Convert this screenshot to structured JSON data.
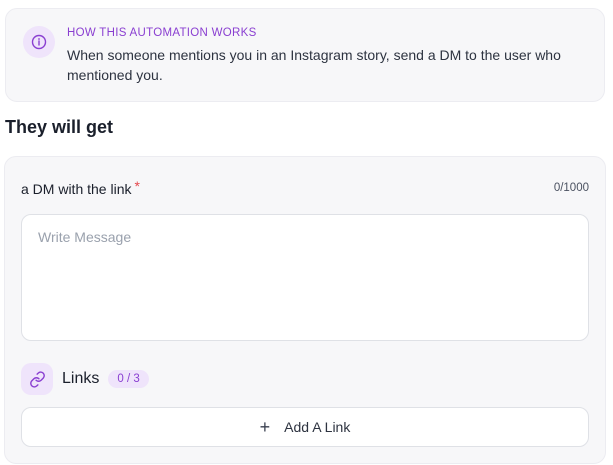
{
  "info": {
    "icon": "info-icon",
    "title": "HOW THIS AUTOMATION WORKS",
    "description": "When someone mentions you in an Instagram story, send a DM to the user who mentioned you."
  },
  "section": {
    "heading": "They will get"
  },
  "dm": {
    "label": "a DM with the link",
    "required_mark": "*",
    "char_count": "0/1000",
    "placeholder": "Write Message",
    "value": ""
  },
  "links": {
    "icon": "link-icon",
    "label": "Links",
    "count": "0 / 3",
    "add_icon": "plus-icon",
    "add_label": "Add A Link"
  },
  "colors": {
    "accent": "#8a3fd1",
    "accent_bg": "#efe4fb",
    "required": "#e5484d",
    "panel_bg": "#f7f7f9"
  }
}
